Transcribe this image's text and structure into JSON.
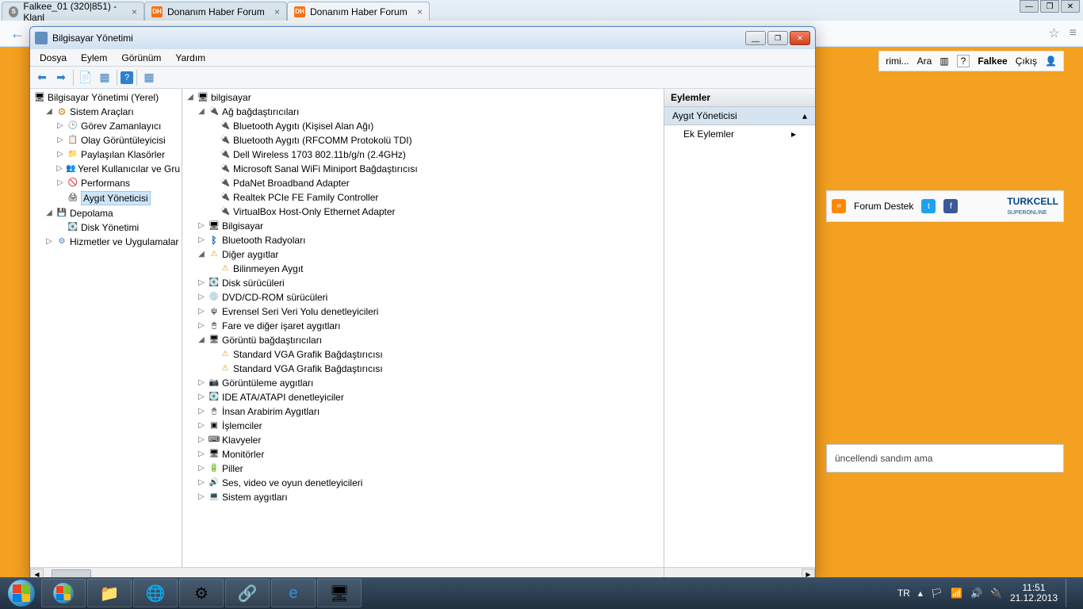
{
  "browser": {
    "tabs": [
      {
        "title": "Falkee_01 (320|851) - Klanl"
      },
      {
        "title": "Donanım Haber Forum"
      },
      {
        "title": "Donanım Haber Forum"
      }
    ]
  },
  "forum_bar": {
    "rimi": "rimi...",
    "search": "Ara",
    "question": "?",
    "user": "Falkee",
    "exit": "Çıkış"
  },
  "forum_social": {
    "destek": "Forum Destek",
    "brand": "TURKCELL",
    "subbrand": "SUPERONLINE"
  },
  "forum_snippet": "üncellendi sandım ama",
  "mmc": {
    "title": "Bilgisayar Yönetimi",
    "menu": [
      "Dosya",
      "Eylem",
      "Görünüm",
      "Yardım"
    ],
    "left_tree": {
      "root": "Bilgisayar Yönetimi (Yerel)",
      "system_tools": "Sistem Araçları",
      "system_children": [
        "Görev Zamanlayıcı",
        "Olay Görüntüleyicisi",
        "Paylaşılan Klasörler",
        "Yerel Kullanıcılar ve Gru",
        "Performans",
        "Aygıt Yöneticisi"
      ],
      "storage": "Depolama",
      "disk_mgmt": "Disk Yönetimi",
      "services": "Hizmetler ve Uygulamalar"
    },
    "center": {
      "root": "bilgisayar",
      "net_adapters": "Ağ bağdaştırıcıları",
      "net_children": [
        "Bluetooth Aygıtı (Kişisel Alan Ağı)",
        "Bluetooth Aygıtı (RFCOMM Protokolü TDI)",
        "Dell Wireless 1703 802.11b/g/n (2.4GHz)",
        "Microsoft Sanal WiFi Miniport Bağdaştırıcısı",
        "PdaNet Broadband Adapter",
        "Realtek PCIe FE Family Controller",
        "VirtualBox Host-Only Ethernet Adapter"
      ],
      "computer": "Bilgisayar",
      "bt_radios": "Bluetooth Radyoları",
      "other": "Diğer aygıtlar",
      "unknown": "Bilinmeyen Aygıt",
      "disk_drives": "Disk sürücüleri",
      "dvd": "DVD/CD-ROM sürücüleri",
      "usb_ctrl": "Evrensel Seri Veri Yolu denetleyicileri",
      "mice": "Fare ve diğer işaret aygıtları",
      "display": "Görüntü bağdaştırıcıları",
      "display_children": [
        "Standard VGA Grafik Bağdaştırıcısı",
        "Standard VGA Grafik Bağdaştırıcısı"
      ],
      "imaging": "Görüntüleme aygıtları",
      "ide": "IDE ATA/ATAPI denetleyiciler",
      "hid": "İnsan Arabirim Aygıtları",
      "cpu": "İşlemciler",
      "kb": "Klavyeler",
      "monitors": "Monitörler",
      "batt": "Piller",
      "sound": "Ses, video ve oyun denetleyicileri",
      "sys": "Sistem aygıtları"
    },
    "actions": {
      "header": "Eylemler",
      "selected": "Aygıt Yöneticisi",
      "more": "Ek Eylemler"
    }
  },
  "tray": {
    "lang": "TR",
    "time": "11:51",
    "date": "21.12.2013"
  }
}
